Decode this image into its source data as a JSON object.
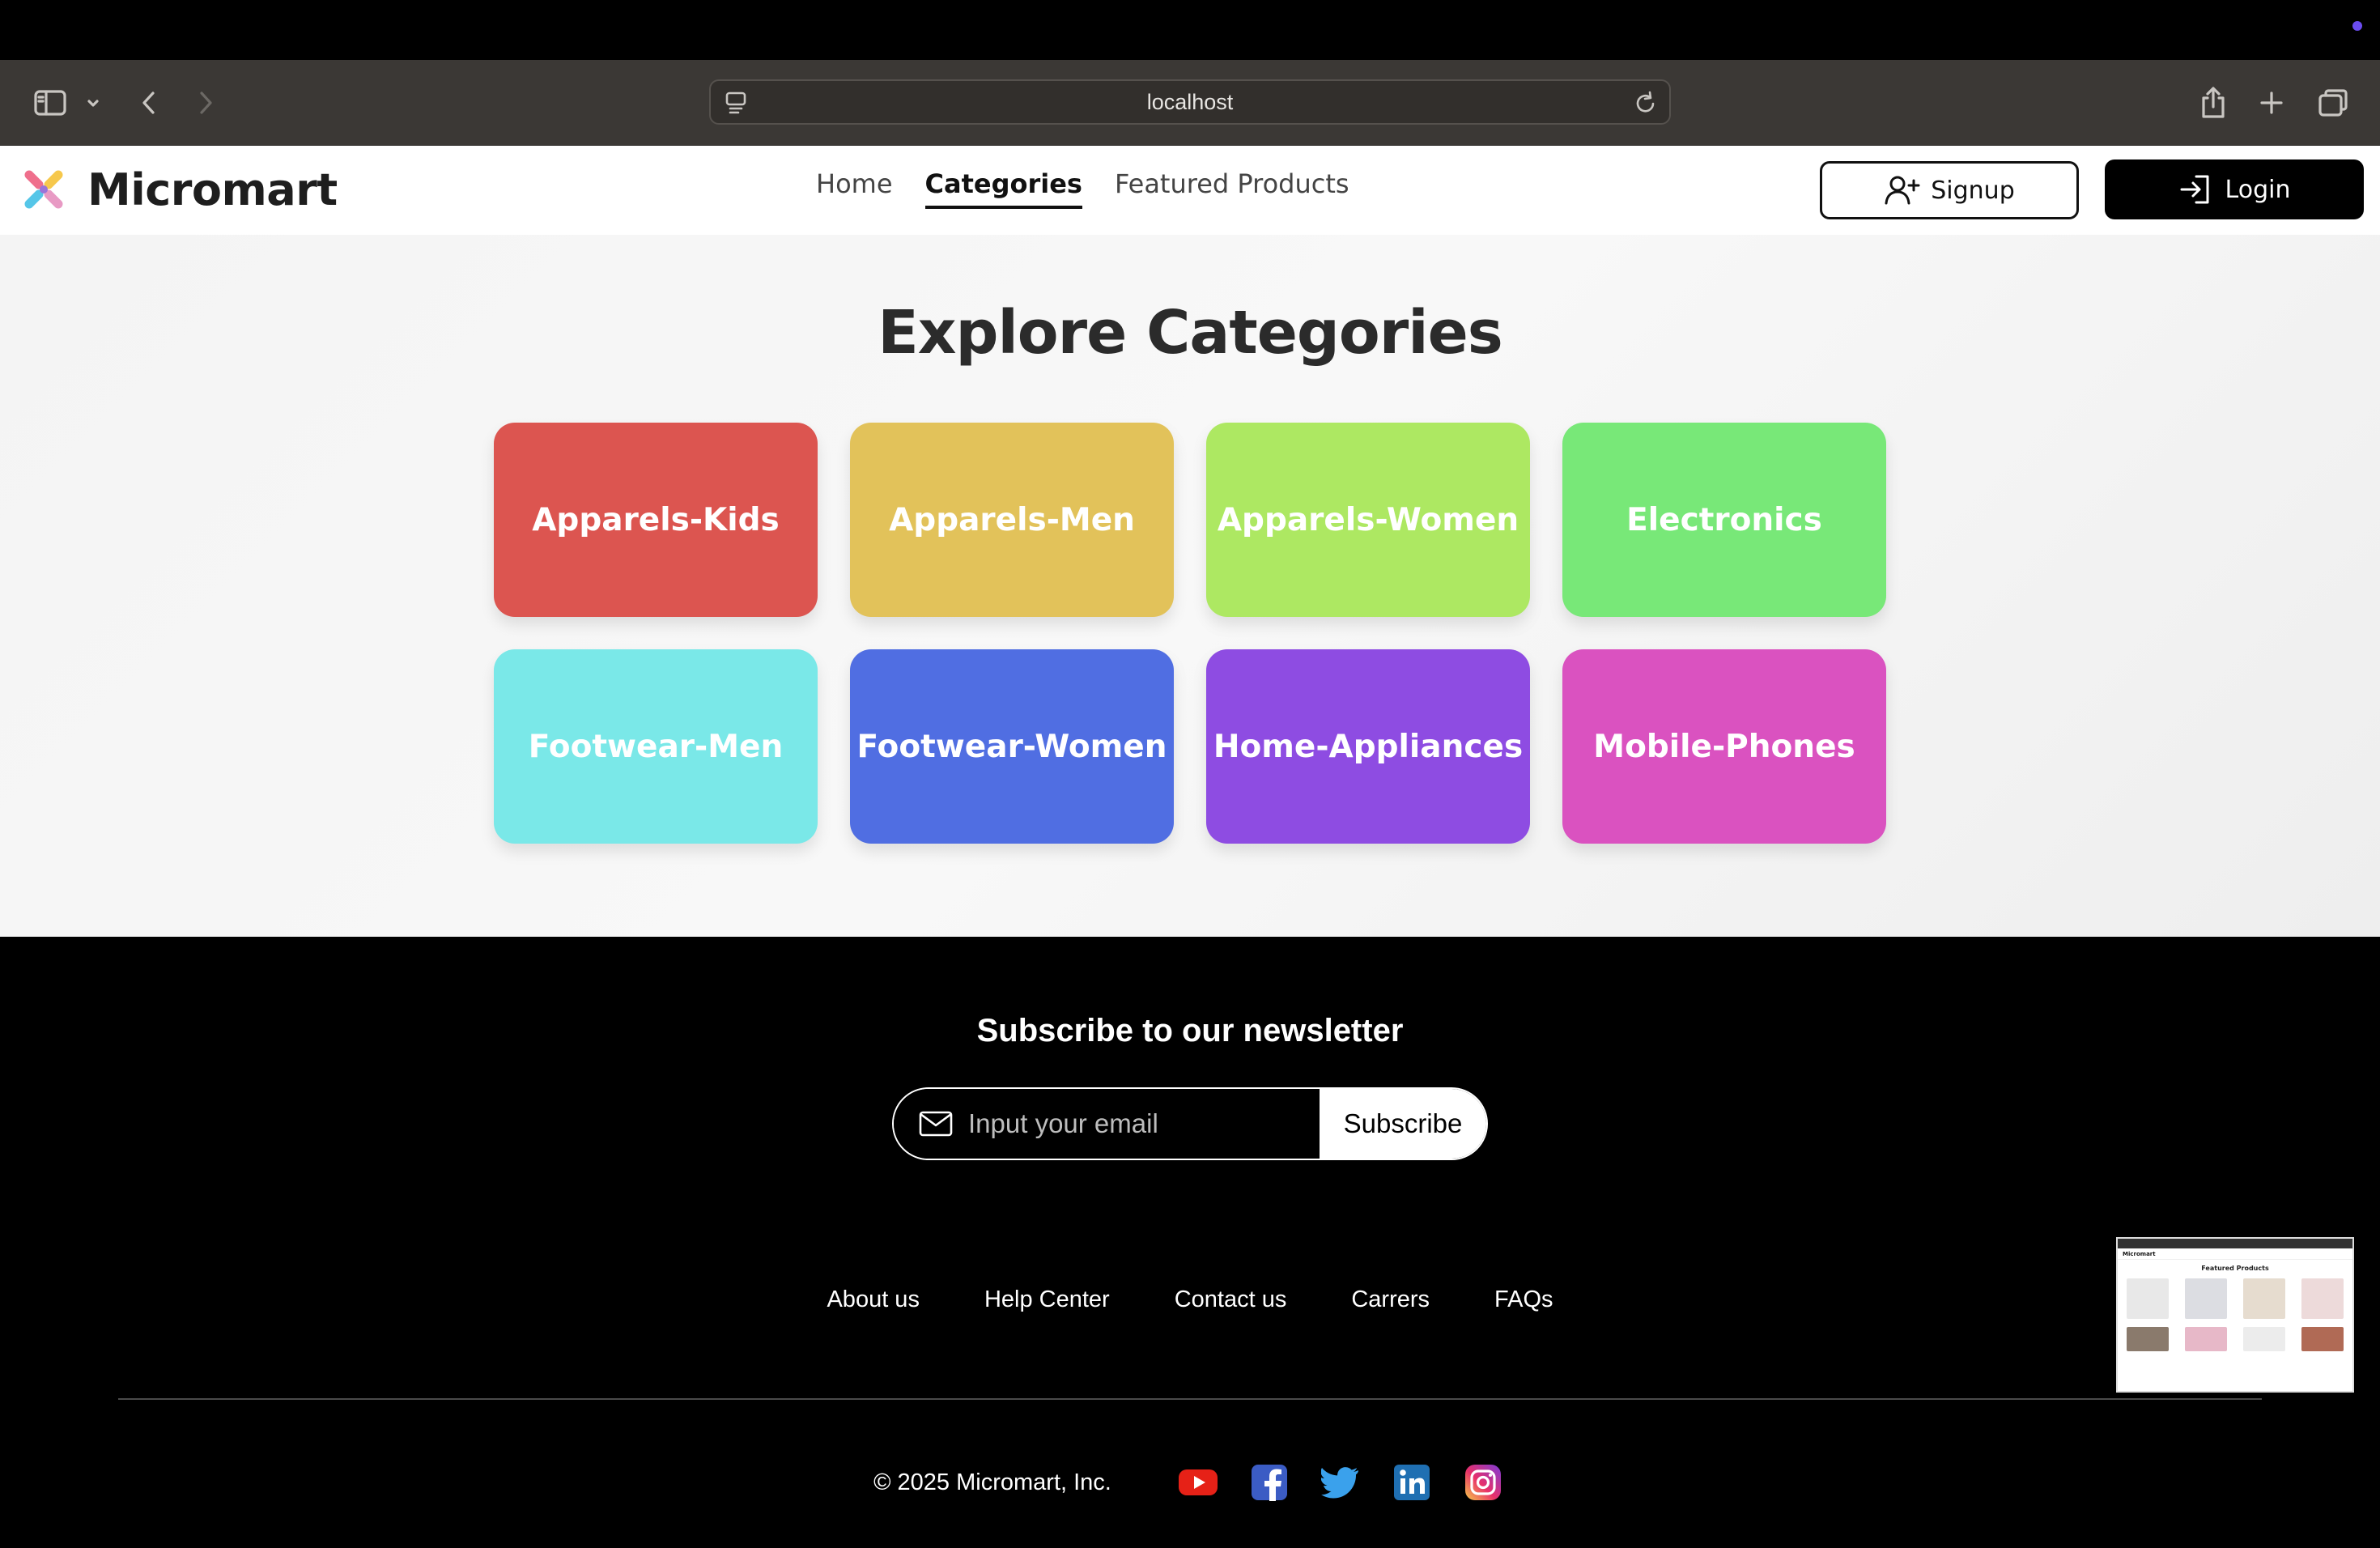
{
  "browser": {
    "url": "localhost",
    "accent_dot_color": "#6b4cf0",
    "icons": [
      "sidebar-icon",
      "chevron-down-icon",
      "back-icon",
      "forward-icon",
      "page-icon",
      "reload-icon",
      "share-icon",
      "new-tab-icon",
      "tabs-overview-icon"
    ]
  },
  "header": {
    "brand": "Micromart",
    "nav": [
      {
        "label": "Home",
        "active": false
      },
      {
        "label": "Categories",
        "active": true
      },
      {
        "label": "Featured Products",
        "active": false
      }
    ],
    "signup_label": "Signup",
    "login_label": "Login"
  },
  "main": {
    "title": "Explore Categories",
    "categories": [
      {
        "label": "Apparels-Kids",
        "color": "#dc5550"
      },
      {
        "label": "Apparels-Men",
        "color": "#e2c25a"
      },
      {
        "label": "Apparels-Women",
        "color": "#ade862"
      },
      {
        "label": "Electronics",
        "color": "#78e878"
      },
      {
        "label": "Footwear-Men",
        "color": "#7ae8e8"
      },
      {
        "label": "Footwear-Women",
        "color": "#506ee2"
      },
      {
        "label": "Home-Appliances",
        "color": "#8e4ce2"
      },
      {
        "label": "Mobile-Phones",
        "color": "#da52c0"
      }
    ]
  },
  "footer": {
    "newsletter_title": "Subscribe to our newsletter",
    "email_placeholder": "Input your email",
    "subscribe_label": "Subscribe",
    "links": [
      "About us",
      "Help Center",
      "Contact us",
      "Carrers",
      "FAQs"
    ],
    "copyright": "© 2025 Micromart, Inc.",
    "social": [
      "youtube-icon",
      "facebook-icon",
      "twitter-icon",
      "linkedin-icon",
      "instagram-icon"
    ]
  },
  "thumbnail": {
    "brand": "Micromart",
    "title": "Featured Products"
  }
}
